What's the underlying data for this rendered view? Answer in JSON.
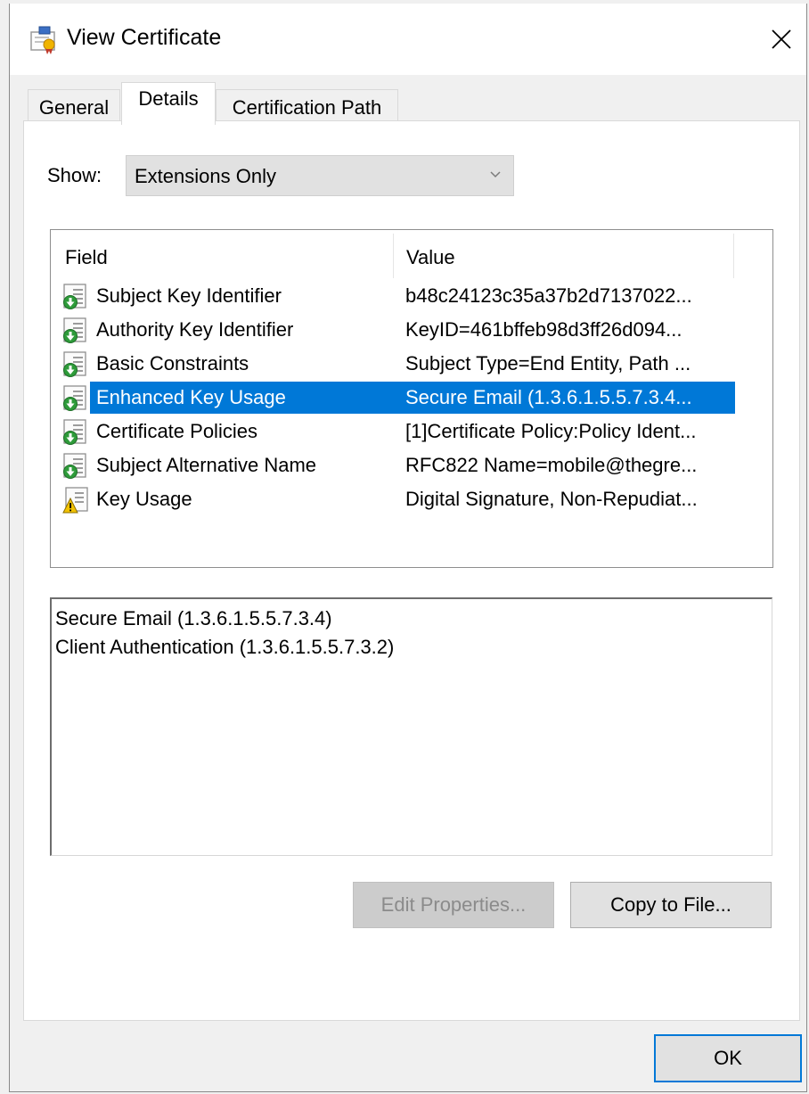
{
  "window": {
    "title": "View Certificate",
    "close_glyph": "✕"
  },
  "tabs": [
    {
      "label": "General",
      "active": false
    },
    {
      "label": "Details",
      "active": true
    },
    {
      "label": "Certification Path",
      "active": false
    }
  ],
  "show": {
    "label": "Show:",
    "selected": "Extensions Only"
  },
  "list": {
    "columns": [
      "Field",
      "Value"
    ],
    "selected_index": 3,
    "rows": [
      {
        "field": "Subject Key Identifier",
        "value": "b48c24123c35a37b2d7137022...",
        "icon": "certificate-extension-icon"
      },
      {
        "field": "Authority Key Identifier",
        "value": "KeyID=461bffeb98d3ff26d094...",
        "icon": "certificate-extension-icon"
      },
      {
        "field": "Basic Constraints",
        "value": "Subject Type=End Entity, Path ...",
        "icon": "certificate-extension-icon"
      },
      {
        "field": "Enhanced Key Usage",
        "value": "Secure Email (1.3.6.1.5.5.7.3.4...",
        "icon": "certificate-extension-icon"
      },
      {
        "field": "Certificate Policies",
        "value": "[1]Certificate Policy:Policy Ident...",
        "icon": "certificate-extension-icon"
      },
      {
        "field": "Subject Alternative Name",
        "value": "RFC822 Name=mobile@thegre...",
        "icon": "certificate-extension-icon"
      },
      {
        "field": "Key Usage",
        "value": "Digital Signature, Non-Repudiat...",
        "icon": "critical-extension-warning-icon"
      }
    ]
  },
  "details": {
    "lines": [
      "Secure Email (1.3.6.1.5.5.7.3.4)",
      "Client Authentication (1.3.6.1.5.5.7.3.2)"
    ]
  },
  "buttons": {
    "edit_properties": "Edit Properties...",
    "copy_to_file": "Copy to File...",
    "ok": "OK"
  },
  "colors": {
    "selection": "#0078d7",
    "accent_green": "#2e9b3a",
    "warning_yellow": "#f2c200"
  }
}
